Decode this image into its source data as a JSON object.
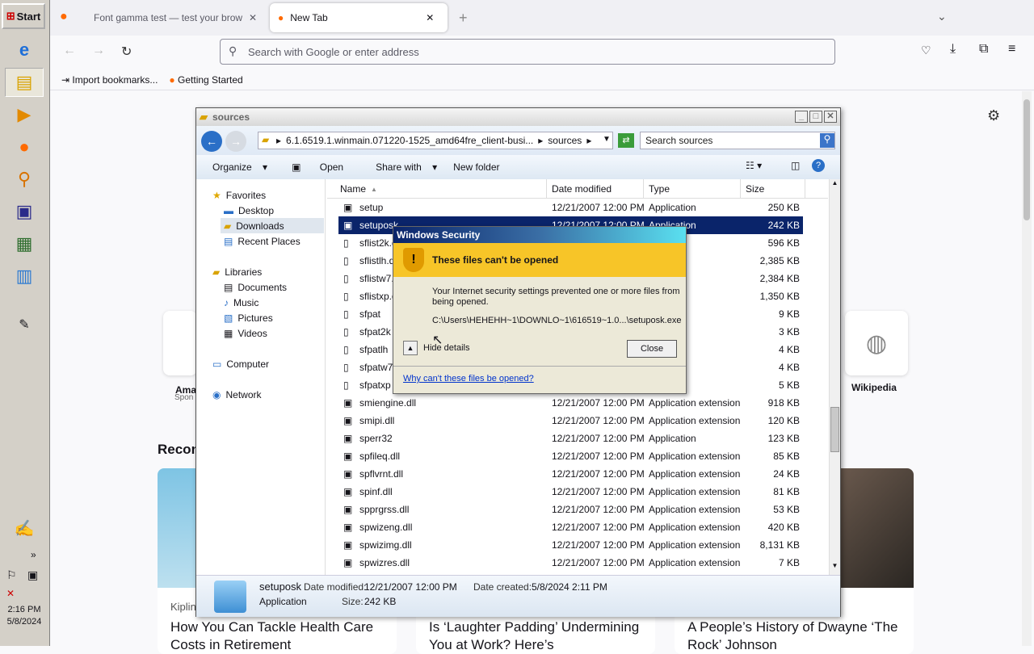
{
  "taskbar": {
    "start_label": "Start",
    "time": "2:16 PM",
    "date": "5/8/2024"
  },
  "browser": {
    "tabs": [
      {
        "label": "Font gamma test — test your browser"
      },
      {
        "label": "New Tab"
      }
    ],
    "url_placeholder": "Search with Google or enter address",
    "bookmarks": [
      "Import bookmarks...",
      "Getting Started"
    ],
    "shortcuts": [
      {
        "label": "Ama",
        "sub": "Spon"
      },
      {
        "label": "Wikipedia"
      }
    ],
    "section_title": "Recon",
    "stories": [
      {
        "source": "Kiplin",
        "title": "How You Can Tackle Health Care Costs in Retirement"
      },
      {
        "title": "Is ‘Laughter Padding’ Undermining You at Work? Here’s"
      },
      {
        "title": "A People’s History of Dwayne ‘The Rock’ Johnson"
      }
    ]
  },
  "explorer": {
    "title": "sources",
    "breadcrumb": [
      "6.1.6519.1.winmain.071220-1525_amd64fre_client-busi...",
      "sources"
    ],
    "search_placeholder": "Search sources",
    "toolbar": {
      "organize": "Organize",
      "open": "Open",
      "share": "Share with",
      "new_folder": "New folder"
    },
    "nav": {
      "favorites": "Favorites",
      "desktop": "Desktop",
      "downloads": "Downloads",
      "recent": "Recent Places",
      "libraries": "Libraries",
      "documents": "Documents",
      "music": "Music",
      "pictures": "Pictures",
      "videos": "Videos",
      "computer": "Computer",
      "network": "Network"
    },
    "columns": {
      "name": "Name",
      "date": "Date modified",
      "type": "Type",
      "size": "Size"
    },
    "files": [
      {
        "name": "setup",
        "date": "12/21/2007 12:00 PM",
        "type": "Application",
        "size": "250 KB"
      },
      {
        "name": "setuposk",
        "date": "12/21/2007 12:00 PM",
        "type": "Application",
        "size": "242 KB"
      },
      {
        "name": "sflist2k.d",
        "date": "",
        "type": "",
        "size": "596 KB"
      },
      {
        "name": "sflistlh.da",
        "date": "",
        "type": "",
        "size": "2,385 KB"
      },
      {
        "name": "sflistw7.c",
        "date": "",
        "type": "",
        "size": "2,384 KB"
      },
      {
        "name": "sflistxp.d",
        "date": "",
        "type": "",
        "size": "1,350 KB"
      },
      {
        "name": "sfpat",
        "date": "",
        "type": "ormation",
        "size": "9 KB"
      },
      {
        "name": "sfpat2k",
        "date": "",
        "type": "ormation",
        "size": "3 KB"
      },
      {
        "name": "sfpatlh",
        "date": "",
        "type": "ormation",
        "size": "4 KB"
      },
      {
        "name": "sfpatw7",
        "date": "",
        "type": "ormation",
        "size": "4 KB"
      },
      {
        "name": "sfpatxp",
        "date": "",
        "type": "ormation",
        "size": "5 KB"
      },
      {
        "name": "smiengine.dll",
        "date": "12/21/2007 12:00 PM",
        "type": "Application extension",
        "size": "918 KB"
      },
      {
        "name": "smipi.dll",
        "date": "12/21/2007 12:00 PM",
        "type": "Application extension",
        "size": "120 KB"
      },
      {
        "name": "sperr32",
        "date": "12/21/2007 12:00 PM",
        "type": "Application",
        "size": "123 KB"
      },
      {
        "name": "spfileq.dll",
        "date": "12/21/2007 12:00 PM",
        "type": "Application extension",
        "size": "85 KB"
      },
      {
        "name": "spflvrnt.dll",
        "date": "12/21/2007 12:00 PM",
        "type": "Application extension",
        "size": "24 KB"
      },
      {
        "name": "spinf.dll",
        "date": "12/21/2007 12:00 PM",
        "type": "Application extension",
        "size": "81 KB"
      },
      {
        "name": "spprgrss.dll",
        "date": "12/21/2007 12:00 PM",
        "type": "Application extension",
        "size": "53 KB"
      },
      {
        "name": "spwizeng.dll",
        "date": "12/21/2007 12:00 PM",
        "type": "Application extension",
        "size": "420 KB"
      },
      {
        "name": "spwizimg.dll",
        "date": "12/21/2007 12:00 PM",
        "type": "Application extension",
        "size": "8,131 KB"
      },
      {
        "name": "spwizres.dll",
        "date": "12/21/2007 12:00 PM",
        "type": "Application extension",
        "size": "7 KB"
      }
    ],
    "details": {
      "name": "setuposk",
      "type": "Application",
      "modified_label": "Date modified:",
      "modified": "12/21/2007 12:00 PM",
      "created_label": "Date created:",
      "created": "5/8/2024 2:11 PM",
      "size_label": "Size:",
      "size": "242 KB"
    }
  },
  "dialog": {
    "title": "Windows Security",
    "heading": "These files can't be opened",
    "message": "Your Internet security settings prevented one or more files from being opened.",
    "path": "C:\\Users\\HEHEHH~1\\DOWNLO~1\\616519~1.0...\\setuposk.exe",
    "hide_details": "Hide details",
    "close": "Close",
    "help_link": "Why can't these files be opened?"
  }
}
